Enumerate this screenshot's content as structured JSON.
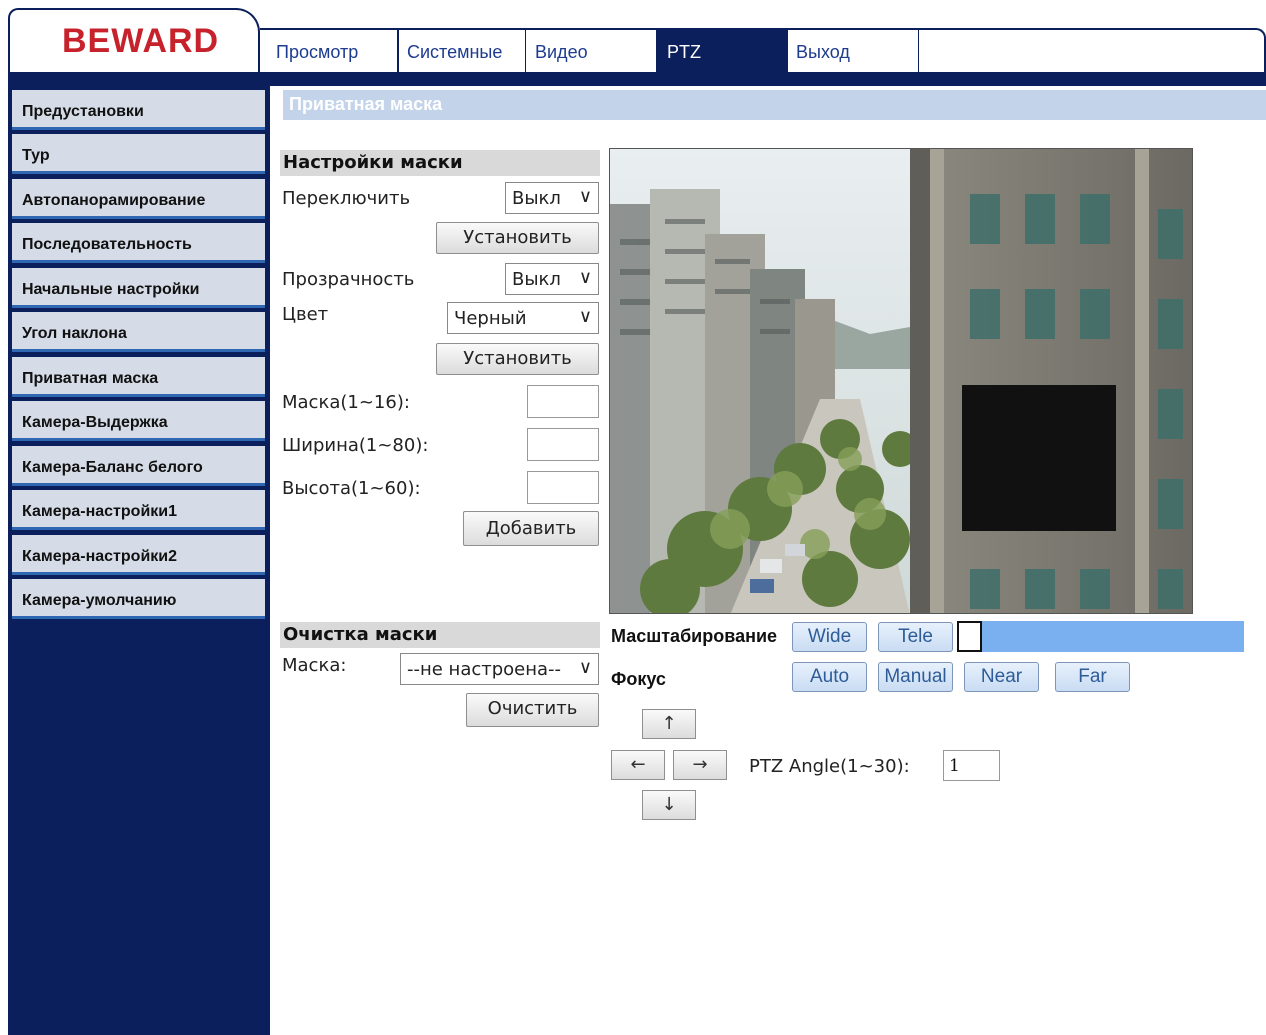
{
  "logo": "BEWARD",
  "tabs": [
    "Просмотр",
    "Системные",
    "Видео",
    "PTZ",
    "Выход"
  ],
  "active_tab": "PTZ",
  "sidebar": {
    "items": [
      {
        "label": "Предустановки"
      },
      {
        "label": "Тур"
      },
      {
        "label": "Автопанорамирование"
      },
      {
        "label": "Последовательность"
      },
      {
        "label": "Начальные настройки"
      },
      {
        "label": "Угол наклона"
      },
      {
        "label": "Приватная маска"
      },
      {
        "label": "Камера-Выдержка"
      },
      {
        "label": "Камера-Баланс белого"
      },
      {
        "label": "Камера-настройки1"
      },
      {
        "label": "Камера-настройки2"
      },
      {
        "label": "Камера-умолчанию"
      }
    ]
  },
  "page_title": "Приватная маска",
  "mask_settings": {
    "header": "Настройки маски",
    "switch_label": "Переключить",
    "switch_value": "Выкл",
    "set_button": "Установить",
    "transparency_label": "Прозрачность",
    "transparency_value": "Выкл",
    "color_label": "Цвет",
    "color_value": "Черный",
    "set_button2": "Установить",
    "mask_label": "Маска(1~16):",
    "mask_value": "",
    "width_label": "Ширина(1~80):",
    "width_value": "",
    "height_label": "Высота(1~60):",
    "height_value": "",
    "add_button": "Добавить"
  },
  "mask_clear": {
    "header": "Очистка маски",
    "mask_label": "Маска:",
    "mask_value": "--не настроена--",
    "clear_button": "Очистить"
  },
  "ptz": {
    "zoom_label": "Масштабирование",
    "wide": "Wide",
    "tele": "Tele",
    "zoom_level": 0,
    "focus_label": "Фокус",
    "auto": "Auto",
    "manual": "Manual",
    "near": "Near",
    "far": "Far",
    "up": "↑",
    "left": "←",
    "right": "→",
    "down": "↓",
    "angle_label": "PTZ Angle(1~30):",
    "angle_value": "1"
  },
  "colors": {
    "navy": "#0b1f5c",
    "logo_red": "#c7222c",
    "sidebar_item": "#d5dce7",
    "title_bar": "#c3d3ea",
    "zoom_bar": "#7ab0f0"
  }
}
